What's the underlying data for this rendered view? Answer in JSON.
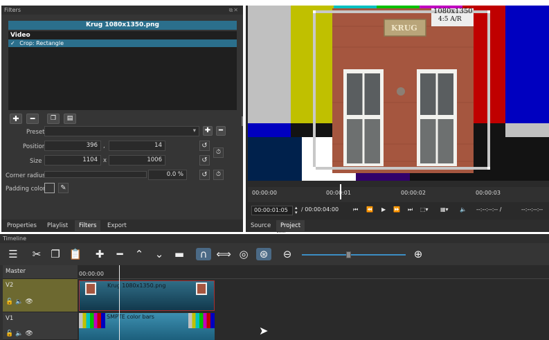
{
  "filters": {
    "title": "Filters",
    "clip_name": "Krug 1080x1350.png",
    "group_label": "Video",
    "active_filter": "Crop: Rectangle",
    "check_mark": "✓",
    "preset_label": "Preset",
    "position_label": "Position",
    "position_x": "396",
    "position_y": "14",
    "position_sep": ",",
    "size_label": "Size",
    "size_w": "1104",
    "size_h": "1006",
    "size_sep": "x",
    "corner_label": "Corner radius",
    "corner_value": "0.0 %",
    "padding_label": "Padding color"
  },
  "left_tabs": [
    "Properties",
    "Playlist",
    "Filters",
    "Export"
  ],
  "left_active_tab": "Filters",
  "player": {
    "overlay_text_line1": "1080x1350",
    "overlay_text_line2": "4:5 A/R",
    "sign_text": "KRUG",
    "ruler_ticks": [
      "00:00:00",
      "00:00:01",
      "00:00:02",
      "00:00:03"
    ],
    "current_time": "00:00:01:05",
    "duration": "/ 00:00:04:00",
    "in_point": "--:--:--:-- /",
    "out_point": "--:--:--:--",
    "tabs": [
      "Source",
      "Project"
    ],
    "active_tab": "Project"
  },
  "timeline": {
    "title": "Timeline",
    "ruler_start": "00:00:00",
    "tracks": [
      {
        "name": "Master"
      },
      {
        "name": "V2",
        "clip": "Krug 1080x1350.png"
      },
      {
        "name": "V1",
        "clip": "SMPTE color bars"
      }
    ]
  },
  "colors": {
    "accent": "#2b6f8c",
    "selected_track": "#6d6930",
    "clip_border": "#aa2e2e"
  }
}
